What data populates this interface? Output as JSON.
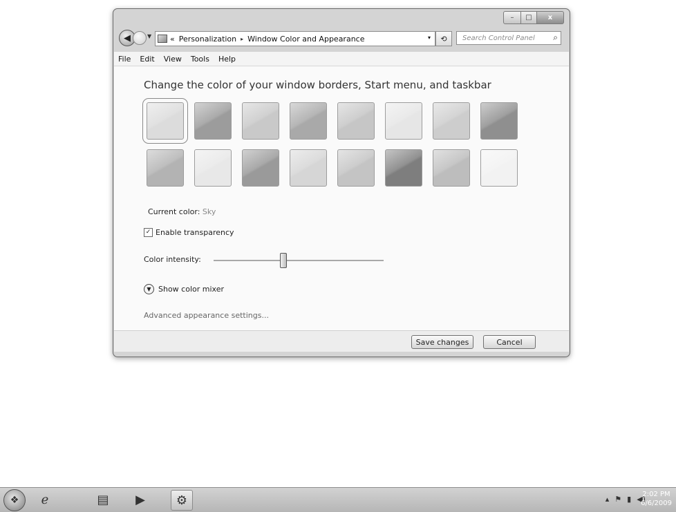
{
  "window": {
    "caption_buttons": {
      "minimize": "–",
      "maximize": "□",
      "close": "x"
    },
    "address": {
      "overflow": "«",
      "crumbs": [
        "Personalization",
        "Window Color and Appearance"
      ],
      "separator": "▸",
      "dropdown": "▾"
    },
    "refresh_icon": "⟲",
    "search": {
      "placeholder": "Search Control Panel",
      "icon": "⌕"
    },
    "menu": [
      "File",
      "Edit",
      "View",
      "Tools",
      "Help"
    ]
  },
  "page": {
    "heading": "Change the color of your window borders, Start menu, and taskbar",
    "swatches": [
      {
        "color": "#dcdcdc",
        "selected": true
      },
      {
        "color": "#9c9c9c"
      },
      {
        "color": "#c9c9c9"
      },
      {
        "color": "#a9a9a9"
      },
      {
        "color": "#c6c6c6"
      },
      {
        "color": "#e6e6e6"
      },
      {
        "color": "#cdcdcd"
      },
      {
        "color": "#8f8f8f"
      },
      {
        "color": "#b3b3b3"
      },
      {
        "color": "#e8e8e8"
      },
      {
        "color": "#9a9a9a"
      },
      {
        "color": "#d6d6d6"
      },
      {
        "color": "#c4c4c4"
      },
      {
        "color": "#7e7e7e"
      },
      {
        "color": "#bdbdbd"
      },
      {
        "color": "#f2f2f2"
      }
    ],
    "current_color_label": "Current color:",
    "current_color_value": "Sky",
    "transparency_label": "Enable transparency",
    "transparency_checked": true,
    "intensity_label": "Color intensity:",
    "intensity_level": 0.41,
    "mixer_label": "Show color mixer",
    "advanced_link": "Advanced appearance settings...",
    "save_label": "Save changes",
    "cancel_label": "Cancel"
  },
  "taskbar": {
    "clock_time": "2:02 PM",
    "clock_date": "6/6/2009"
  }
}
